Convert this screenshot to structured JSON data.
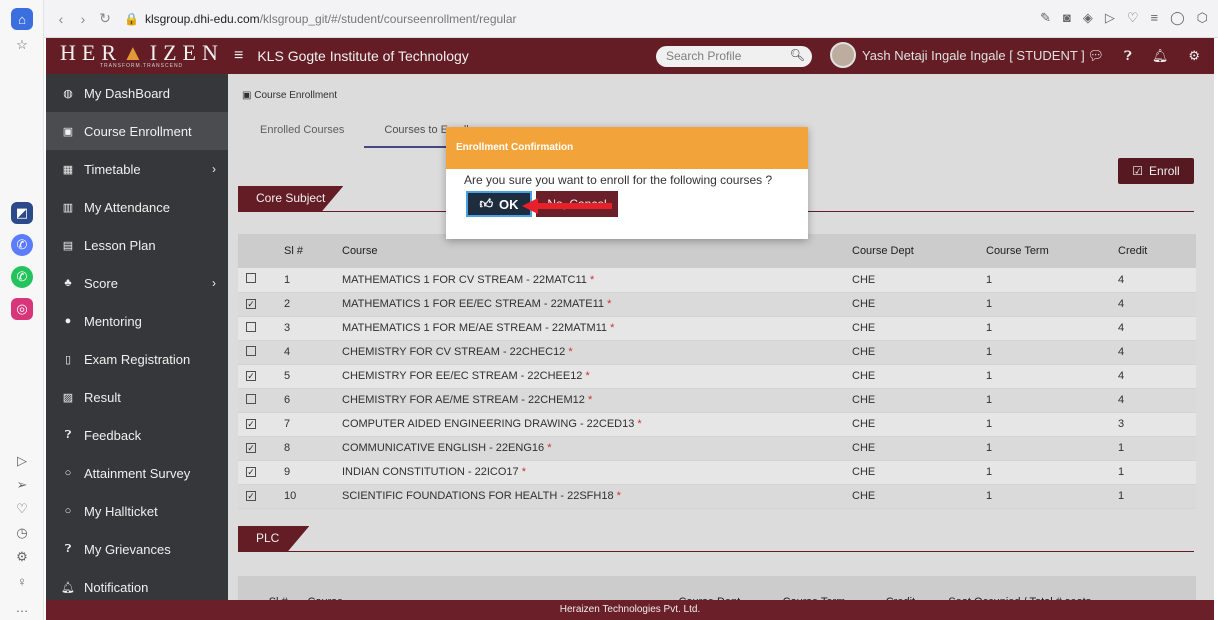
{
  "browser": {
    "url_host": "klsgroup.dhi-edu.com",
    "url_path": "/klsgroup_git/#/student/courseenrollment/regular"
  },
  "header": {
    "logo_text": "HERAIZEN",
    "logo_sub": "TRANSFORM.TRANSCEND",
    "institution": "KLS Gogte Institute of Technology",
    "search_placeholder": "Search Profile",
    "user": "Yash Netaji Ingale Ingale [ STUDENT ]"
  },
  "sidebar": {
    "items": [
      {
        "label": "My DashBoard",
        "icon": "dashboard-icon"
      },
      {
        "label": "Course Enrollment",
        "icon": "course-icon",
        "active": true
      },
      {
        "label": "Timetable",
        "icon": "calendar-icon",
        "has_children": true
      },
      {
        "label": "My Attendance",
        "icon": "bar-chart-icon"
      },
      {
        "label": "Lesson Plan",
        "icon": "lesson-icon"
      },
      {
        "label": "Score",
        "icon": "sitemap-icon",
        "has_children": true
      },
      {
        "label": "Mentoring",
        "icon": "user-circle-icon"
      },
      {
        "label": "Exam Registration",
        "icon": "exam-icon"
      },
      {
        "label": "Result",
        "icon": "result-icon"
      },
      {
        "label": "Feedback",
        "icon": "question-icon"
      },
      {
        "label": "Attainment Survey",
        "icon": "circle-icon"
      },
      {
        "label": "My Hallticket",
        "icon": "circle-icon"
      },
      {
        "label": "My Grievances",
        "icon": "question-icon"
      },
      {
        "label": "Notification",
        "icon": "bell-icon"
      }
    ]
  },
  "main": {
    "breadcrumb": "Course Enrollment",
    "tabs": [
      {
        "label": "Enrolled Courses",
        "active": false
      },
      {
        "label": "Courses to Enroll",
        "active": true
      }
    ],
    "enroll_label": "Enroll",
    "core_section": "Core Subject",
    "core_headers": [
      "Sl #",
      "Course",
      "Course Dept",
      "Course Term",
      "Credit"
    ],
    "core_rows": [
      {
        "checked": false,
        "sl": "1",
        "course": "MATHEMATICS 1 FOR CV STREAM - 22MATC11",
        "dept": "CHE",
        "term": "1",
        "credit": "4"
      },
      {
        "checked": true,
        "sl": "2",
        "course": "MATHEMATICS 1 FOR EE/EC STREAM - 22MATE11",
        "dept": "CHE",
        "term": "1",
        "credit": "4"
      },
      {
        "checked": false,
        "sl": "3",
        "course": "MATHEMATICS 1 FOR ME/AE STREAM - 22MATM11",
        "dept": "CHE",
        "term": "1",
        "credit": "4"
      },
      {
        "checked": false,
        "sl": "4",
        "course": "CHEMISTRY FOR CV STREAM - 22CHEC12",
        "dept": "CHE",
        "term": "1",
        "credit": "4"
      },
      {
        "checked": true,
        "sl": "5",
        "course": "CHEMISTRY FOR EE/EC STREAM - 22CHEE12",
        "dept": "CHE",
        "term": "1",
        "credit": "4"
      },
      {
        "checked": false,
        "sl": "6",
        "course": "CHEMISTRY FOR AE/ME STREAM - 22CHEM12",
        "dept": "CHE",
        "term": "1",
        "credit": "4"
      },
      {
        "checked": true,
        "sl": "7",
        "course": "COMPUTER AIDED ENGINEERING DRAWING - 22CED13",
        "dept": "CHE",
        "term": "1",
        "credit": "3"
      },
      {
        "checked": true,
        "sl": "8",
        "course": "COMMUNICATIVE ENGLISH - 22ENG16",
        "dept": "CHE",
        "term": "1",
        "credit": "1"
      },
      {
        "checked": true,
        "sl": "9",
        "course": "INDIAN CONSTITUTION - 22ICO17",
        "dept": "CHE",
        "term": "1",
        "credit": "1"
      },
      {
        "checked": true,
        "sl": "10",
        "course": "SCIENTIFIC FOUNDATIONS FOR HEALTH - 22SFH18",
        "dept": "CHE",
        "term": "1",
        "credit": "1"
      }
    ],
    "plc_section": "PLC",
    "plc_headers": [
      "Sl #",
      "Course",
      "Course Dept",
      "Course Term",
      "Credit",
      "Seat Occupied / Total # seats"
    ]
  },
  "modal": {
    "title": "Enrollment Confirmation",
    "message": "Are you sure you want to enroll for the following courses ?",
    "ok_label": "OK",
    "cancel_label": "No, Cancel"
  },
  "footer": "Heraizen Technologies Pvt. Ltd.",
  "colors": {
    "brand": "#6b1f28",
    "sidebar": "#3a3b3e",
    "modal_header": "#f2a43a",
    "ok_button": "#1d2d3e",
    "arrow": "#e8202a"
  }
}
